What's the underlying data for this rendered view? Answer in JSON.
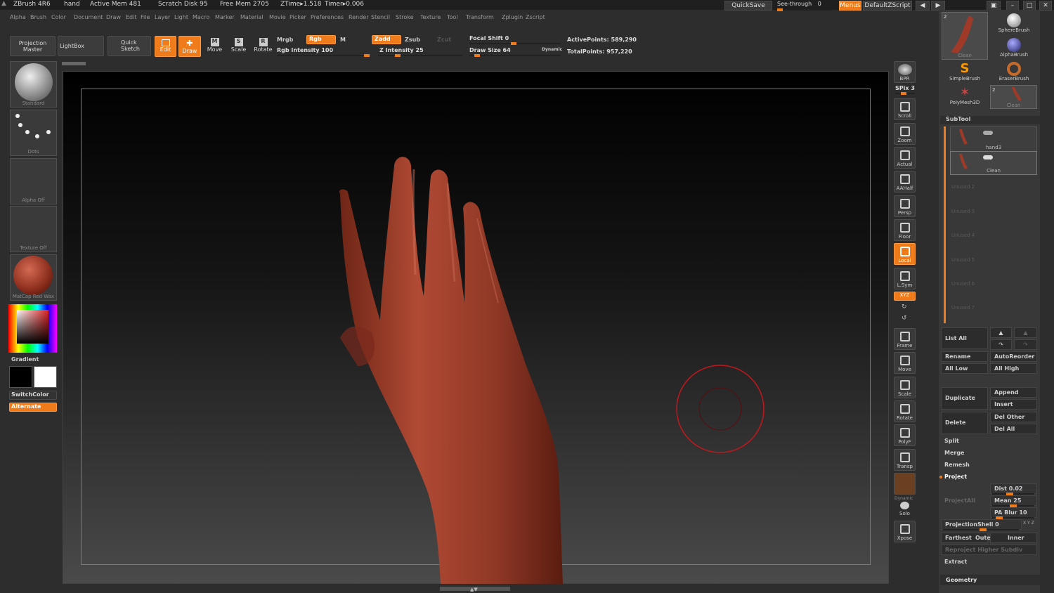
{
  "titlebar": {
    "app": "ZBrush 4R6",
    "doc": "hand",
    "active_mem": "Active Mem 481",
    "scratch": "Scratch Disk 95",
    "free_mem": "Free Mem 2705",
    "ztime": "ZTime▸1.518",
    "timer": "Timer▸0.006",
    "quicksave": "QuickSave",
    "seethrough": "See-through",
    "seethrough_val": "0",
    "menus": "Menus",
    "script": "DefaultZScript"
  },
  "menu": [
    "Alpha",
    "Brush",
    "Color",
    "Document",
    "Draw",
    "Edit",
    "File",
    "Layer",
    "Light",
    "Macro",
    "Marker",
    "Material",
    "Movie",
    "Picker",
    "Preferences",
    "Render",
    "Stencil",
    "Stroke",
    "Texture",
    "Tool",
    "Transform",
    "Zplugin",
    "Zscript"
  ],
  "toolbar": {
    "projection_master": "Projection Master",
    "lightbox": "LightBox",
    "quick_sketch": "Quick Sketch",
    "edit": "Edit",
    "draw": "Draw",
    "move": "Move",
    "scale": "Scale",
    "rotate": "Rotate",
    "mrgb": "Mrgb",
    "rgb": "Rgb",
    "m": "M",
    "rgb_intensity": "Rgb Intensity 100",
    "zadd": "Zadd",
    "zsub": "Zsub",
    "zcut": "Zcut",
    "z_intensity": "Z Intensity 25",
    "focal_shift": "Focal Shift 0",
    "draw_size": "Draw Size 64",
    "dynamic": "Dynamic",
    "active_points": "ActivePoints: 589,290",
    "total_points": "TotalPoints: 957,220"
  },
  "sliders": {
    "rgb_intensity": 1.0,
    "z_intensity": 0.25,
    "focal_shift": 0.5,
    "draw_size": 0.1
  },
  "left": {
    "brush": "Standard",
    "stroke": "Dots",
    "alpha": "Alpha Off",
    "texture": "Texture Off",
    "material": "MatCap Red Wax",
    "gradient": "Gradient",
    "switchcolor": "SwitchColor",
    "alternate": "Alternate"
  },
  "right": {
    "bpr": "BPR",
    "spix": "SPix 3",
    "scroll": "Scroll",
    "zoom": "Zoom",
    "actual": "Actual",
    "aahalf": "AAHalf",
    "persp": "Persp",
    "floor": "Floor",
    "local": "Local",
    "lsym": "L.Sym",
    "xyz": "XYZ",
    "frame": "Frame",
    "move": "Move",
    "scale": "Scale",
    "rotate": "Rotate",
    "polyf": "PolyF",
    "transp": "Transp",
    "dynamic": "Dynamic",
    "solo": "Solo",
    "xpose": "Xpose"
  },
  "tools": {
    "clean": "Clean",
    "sphere": "SphereBrush",
    "alpha": "AlphaBrush",
    "simple": "SimpleBrush",
    "eraser": "EraserBrush",
    "polymesh": "PolyMesh3D",
    "clean2": "Clean",
    "count": "2",
    "count2": "2"
  },
  "subtool": {
    "title": "SubTool",
    "items": [
      "hand3",
      "Clean"
    ],
    "unused": [
      "Unused 2",
      "Unused 3",
      "Unused 4",
      "Unused 5",
      "Unused 6",
      "Unused 7"
    ],
    "list_all": "List All",
    "rename": "Rename",
    "autoreorder": "AutoReorder",
    "all_low": "All Low",
    "all_high": "All High",
    "duplicate": "Duplicate",
    "append": "Append",
    "insert": "Insert",
    "delete": "Delete",
    "del_other": "Del Other",
    "del_all": "Del All",
    "split": "Split",
    "merge": "Merge",
    "remesh": "Remesh",
    "project": "Project",
    "projectall": "ProjectAll",
    "dist": "Dist 0.02",
    "mean": "Mean 25",
    "pablur": "PA Blur 10",
    "projectionshell": "ProjectionShell 0",
    "xyz": "X Y Z",
    "farthest": "Farthest",
    "outer": "Outer",
    "inner": "Inner",
    "reproject": "Reproject Higher Subdiv",
    "extract": "Extract",
    "geometry": "Geometry"
  },
  "colors": {
    "accent": "#f07b1a",
    "skin": "#9b3c2a",
    "cursor": "#c0181c"
  }
}
